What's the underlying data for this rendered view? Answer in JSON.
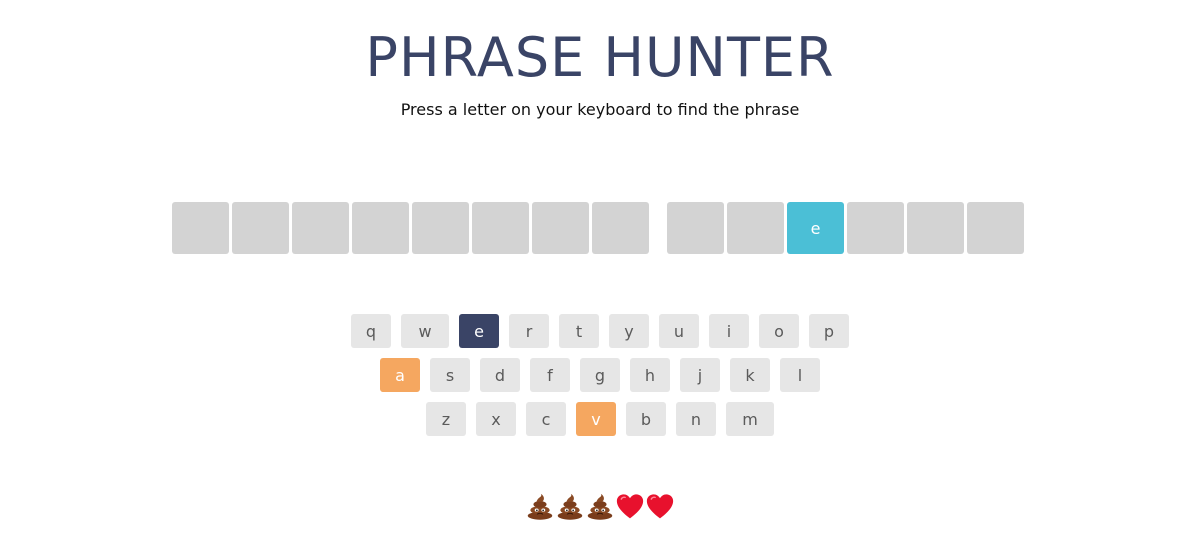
{
  "header": {
    "title": "PHRASE HUNTER",
    "subtitle": "Press a letter on your keyboard to find the phrase"
  },
  "phrase": {
    "words": [
      [
        {
          "letter": "",
          "revealed": false
        },
        {
          "letter": "",
          "revealed": false
        },
        {
          "letter": "",
          "revealed": false
        },
        {
          "letter": "",
          "revealed": false
        },
        {
          "letter": "",
          "revealed": false
        },
        {
          "letter": "",
          "revealed": false
        },
        {
          "letter": "",
          "revealed": false
        },
        {
          "letter": "",
          "revealed": false
        }
      ],
      [
        {
          "letter": "",
          "revealed": false
        },
        {
          "letter": "",
          "revealed": false
        },
        {
          "letter": "e",
          "revealed": true
        },
        {
          "letter": "",
          "revealed": false
        },
        {
          "letter": "",
          "revealed": false
        },
        {
          "letter": "",
          "revealed": false
        }
      ]
    ]
  },
  "keyboard": {
    "rows": [
      [
        {
          "key": "q",
          "state": "default"
        },
        {
          "key": "w",
          "state": "default"
        },
        {
          "key": "e",
          "state": "correct"
        },
        {
          "key": "r",
          "state": "default"
        },
        {
          "key": "t",
          "state": "default"
        },
        {
          "key": "y",
          "state": "default"
        },
        {
          "key": "u",
          "state": "default"
        },
        {
          "key": "i",
          "state": "default"
        },
        {
          "key": "o",
          "state": "default"
        },
        {
          "key": "p",
          "state": "default"
        }
      ],
      [
        {
          "key": "a",
          "state": "wrong"
        },
        {
          "key": "s",
          "state": "default"
        },
        {
          "key": "d",
          "state": "default"
        },
        {
          "key": "f",
          "state": "default"
        },
        {
          "key": "g",
          "state": "default"
        },
        {
          "key": "h",
          "state": "default"
        },
        {
          "key": "j",
          "state": "default"
        },
        {
          "key": "k",
          "state": "default"
        },
        {
          "key": "l",
          "state": "default"
        }
      ],
      [
        {
          "key": "z",
          "state": "default"
        },
        {
          "key": "x",
          "state": "default"
        },
        {
          "key": "c",
          "state": "default"
        },
        {
          "key": "v",
          "state": "wrong"
        },
        {
          "key": "b",
          "state": "default"
        },
        {
          "key": "n",
          "state": "default"
        },
        {
          "key": "m",
          "state": "default"
        }
      ]
    ]
  },
  "lives": [
    {
      "icon": "poop-icon",
      "state": "lost"
    },
    {
      "icon": "poop-icon",
      "state": "lost"
    },
    {
      "icon": "poop-icon",
      "state": "lost"
    },
    {
      "icon": "heart-icon",
      "state": "remaining"
    },
    {
      "icon": "heart-icon",
      "state": "remaining"
    }
  ],
  "colors": {
    "title": "#3a4466",
    "box_hidden": "#d3d3d3",
    "box_revealed": "#4bbfd6",
    "key_default": "#e6e6e6",
    "key_correct": "#3a4466",
    "key_wrong": "#f5a760",
    "heart": "#e8112d",
    "poop": "#7a3d1c"
  }
}
